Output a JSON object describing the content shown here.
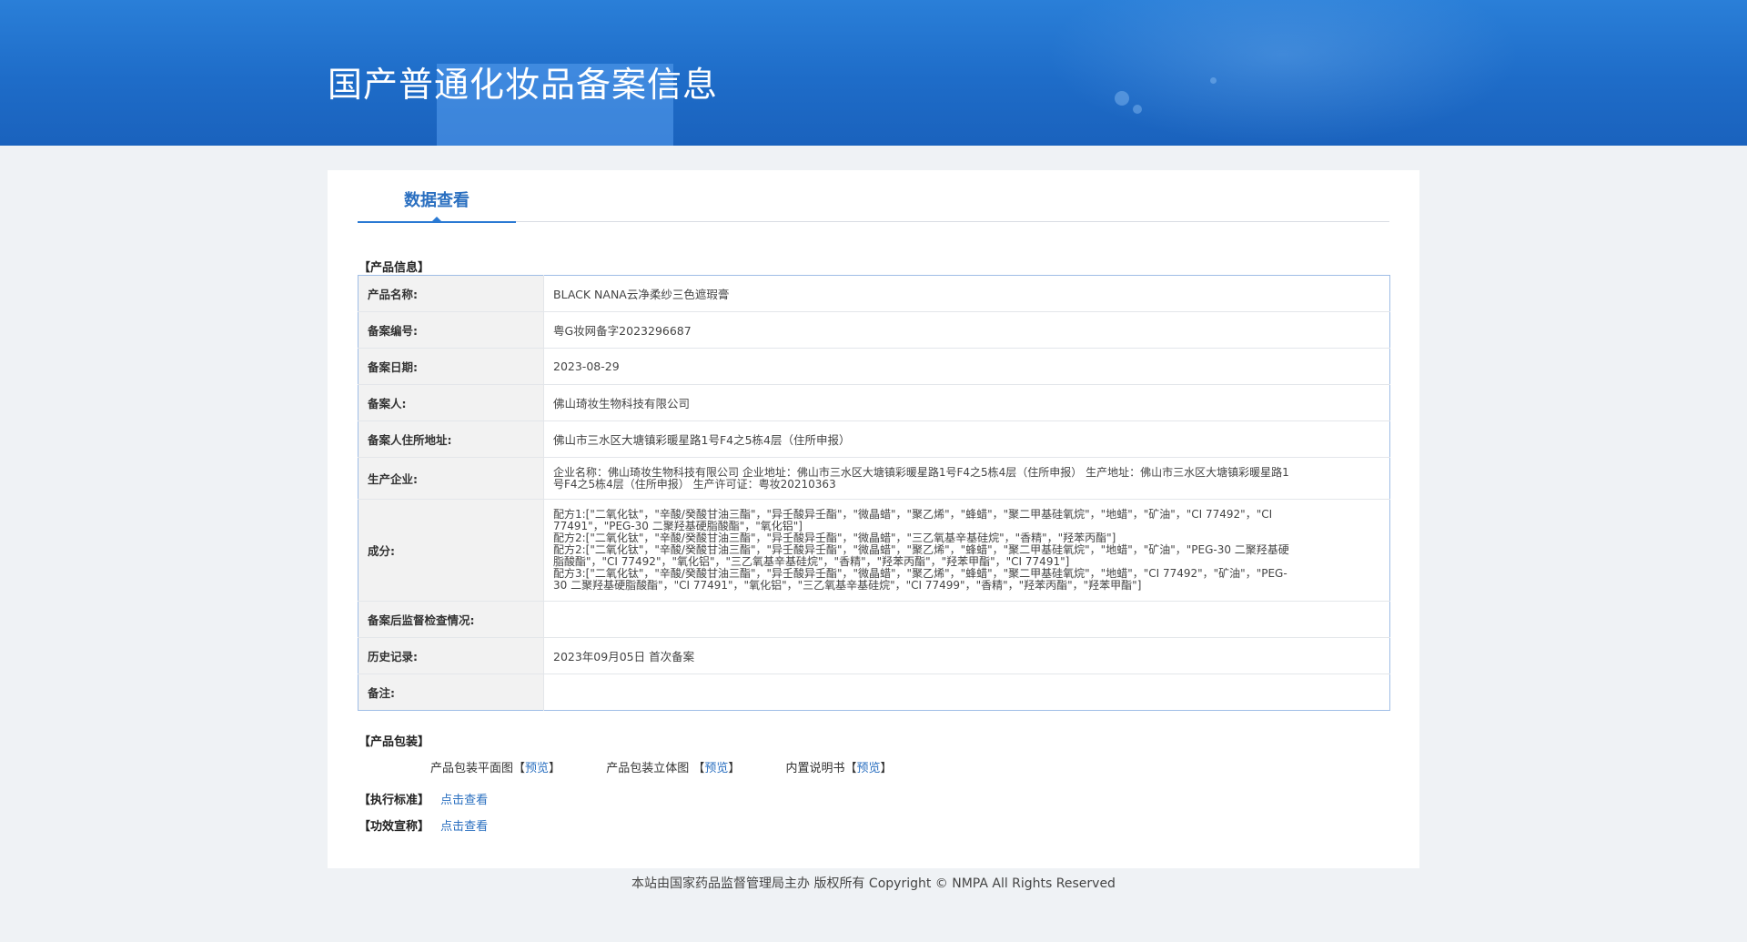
{
  "header": {
    "title": "国产普通化妆品备案信息"
  },
  "tabs": [
    {
      "label": "数据查看",
      "active": true
    }
  ],
  "product_info": {
    "section_label": "【产品信息】",
    "rows": [
      {
        "key": "产品名称:",
        "value": "BLACK NANA云净柔纱三色遮瑕膏"
      },
      {
        "key": "备案编号:",
        "value": "粤G妆网备字2023296687"
      },
      {
        "key": "备案日期:",
        "value": "2023-08-29"
      },
      {
        "key": "备案人:",
        "value": "佛山琦妆生物科技有限公司"
      },
      {
        "key": "备案人住所地址:",
        "value": "佛山市三水区大塘镇彩暖星路1号F4之5栋4层（住所申报）"
      },
      {
        "key": "生产企业:",
        "value": "企业名称：佛山琦妆生物科技有限公司 企业地址：佛山市三水区大塘镇彩暖星路1号F4之5栋4层（住所申报） 生产地址：佛山市三水区大塘镇彩暖星路1号F4之5栋4层（住所申报） 生产许可证：粤妆20210363"
      },
      {
        "key": "成分:",
        "lines": [
          "配方1:[\"二氧化钛\"，\"辛酸/癸酸甘油三酯\"，\"异壬酸异壬酯\"，\"微晶蜡\"，\"聚乙烯\"，\"蜂蜡\"，\"聚二甲基硅氧烷\"，\"地蜡\"，\"矿油\"，\"CI 77492\"，\"CI 77491\"，\"PEG-30 二聚羟基硬脂酸酯\"，\"氧化铝\"]",
          "配方2:[\"二氧化钛\"，\"辛酸/癸酸甘油三酯\"，\"异壬酸异壬酯\"，\"微晶蜡\"，\"三乙氧基辛基硅烷\"，\"香精\"，\"羟苯丙酯\"]",
          "配方2:[\"二氧化钛\"，\"辛酸/癸酸甘油三酯\"，\"异壬酸异壬酯\"，\"微晶蜡\"，\"聚乙烯\"，\"蜂蜡\"，\"聚二甲基硅氧烷\"，\"地蜡\"，\"矿油\"，\"PEG-30 二聚羟基硬脂酸酯\"，\"CI 77492\"，\"氧化铝\"，\"三乙氧基辛基硅烷\"，\"香精\"，\"羟苯丙酯\"，\"羟苯甲酯\"，\"CI 77491\"]",
          "配方3:[\"二氧化钛\"，\"辛酸/癸酸甘油三酯\"，\"异壬酸异壬酯\"，\"微晶蜡\"，\"聚乙烯\"，\"蜂蜡\"，\"聚二甲基硅氧烷\"，\"地蜡\"，\"CI 77492\"，\"矿油\"，\"PEG-30 二聚羟基硬脂酸酯\"，\"CI 77491\"，\"氧化铝\"，\"三乙氧基辛基硅烷\"，\"CI 77499\"，\"香精\"，\"羟苯丙酯\"，\"羟苯甲酯\"]"
        ]
      },
      {
        "key": "备案后监督检查情况:",
        "value": ""
      },
      {
        "key": "历史记录:",
        "value": "2023年09月05日 首次备案"
      },
      {
        "key": "备注:",
        "value": ""
      }
    ]
  },
  "packaging": {
    "section_label": "【产品包装】",
    "items": [
      {
        "label": "产品包装平面图",
        "link": "预览"
      },
      {
        "label": "产品包装立体图",
        "link": "预览"
      },
      {
        "label": "内置说明书",
        "link": "预览"
      }
    ]
  },
  "standards": {
    "label": "【执行标准】",
    "link": "点击查看"
  },
  "efficacy": {
    "label": "【功效宣称】",
    "link": "点击查看"
  },
  "footer": {
    "text": "本站由国家药品监督管理局主办 版权所有 Copyright © NMPA All Rights Reserved"
  }
}
